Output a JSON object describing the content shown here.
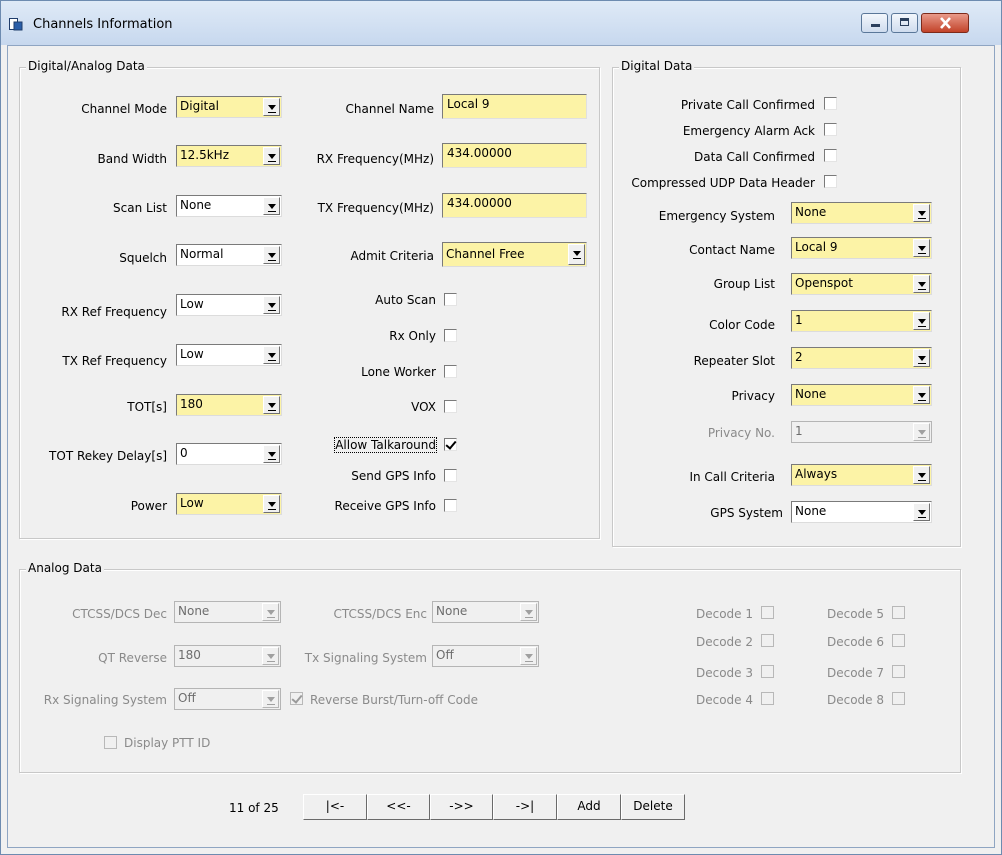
{
  "window": {
    "title": "Channels Information",
    "buttons": {
      "minimize": "minimize-icon",
      "maximize": "maximize-icon",
      "close": "close-icon"
    }
  },
  "digital_analog": {
    "legend": "Digital/Analog Data",
    "channel_mode": {
      "label": "Channel Mode",
      "value": "Digital"
    },
    "band_width": {
      "label": "Band Width",
      "value": "12.5kHz"
    },
    "scan_list": {
      "label": "Scan List",
      "value": "None"
    },
    "squelch": {
      "label": "Squelch",
      "value": "Normal"
    },
    "rx_ref": {
      "label": "RX Ref Frequency",
      "value": "Low"
    },
    "tx_ref": {
      "label": "TX Ref Frequency",
      "value": "Low"
    },
    "tot": {
      "label": "TOT[s]",
      "value": "180"
    },
    "tot_rekey": {
      "label": "TOT Rekey Delay[s]",
      "value": "0"
    },
    "power": {
      "label": "Power",
      "value": "Low"
    },
    "channel_name": {
      "label": "Channel Name",
      "value": "Local 9"
    },
    "rx_freq": {
      "label": "RX Frequency(MHz)",
      "value": "434.00000"
    },
    "tx_freq": {
      "label": "TX Frequency(MHz)",
      "value": "434.00000"
    },
    "admit": {
      "label": "Admit Criteria",
      "value": "Channel Free"
    },
    "auto_scan": {
      "label": "Auto Scan",
      "checked": false
    },
    "rx_only": {
      "label": "Rx Only",
      "checked": false
    },
    "lone_worker": {
      "label": "Lone Worker",
      "checked": false
    },
    "vox": {
      "label": "VOX",
      "checked": false
    },
    "allow_talkaround": {
      "label": "Allow Talkaround",
      "checked": true
    },
    "send_gps": {
      "label": "Send GPS Info",
      "checked": false
    },
    "receive_gps": {
      "label": "Receive GPS Info",
      "checked": false
    }
  },
  "digital": {
    "legend": "Digital Data",
    "private_call": {
      "label": "Private Call Confirmed",
      "checked": false
    },
    "emergency_ack": {
      "label": "Emergency Alarm Ack",
      "checked": false
    },
    "data_call": {
      "label": "Data Call Confirmed",
      "checked": false
    },
    "compressed_udp": {
      "label": "Compressed UDP Data Header",
      "checked": false
    },
    "emergency_system": {
      "label": "Emergency System",
      "value": "None"
    },
    "contact_name": {
      "label": "Contact Name",
      "value": "Local 9"
    },
    "group_list": {
      "label": "Group List",
      "value": "Openspot"
    },
    "color_code": {
      "label": "Color Code",
      "value": "1"
    },
    "repeater_slot": {
      "label": "Repeater Slot",
      "value": "2"
    },
    "privacy": {
      "label": "Privacy",
      "value": "None"
    },
    "privacy_no": {
      "label": "Privacy No.",
      "value": "1"
    },
    "in_call": {
      "label": "In Call Criteria",
      "value": "Always"
    },
    "gps_system": {
      "label": "GPS System",
      "value": "None"
    }
  },
  "analog": {
    "legend": "Analog Data",
    "ctcss_dec": {
      "label": "CTCSS/DCS Dec",
      "value": "None"
    },
    "ctcss_enc": {
      "label": "CTCSS/DCS Enc",
      "value": "None"
    },
    "qt_reverse": {
      "label": "QT Reverse",
      "value": "180"
    },
    "tx_signaling": {
      "label": "Tx Signaling System",
      "value": "Off"
    },
    "rx_signaling": {
      "label": "Rx Signaling System",
      "value": "Off"
    },
    "reverse_burst": {
      "label": "Reverse Burst/Turn-off Code",
      "checked": true
    },
    "display_ptt": {
      "label": "Display PTT ID",
      "checked": false
    },
    "decodes": [
      "Decode 1",
      "Decode 2",
      "Decode 3",
      "Decode 4",
      "Decode 5",
      "Decode 6",
      "Decode 7",
      "Decode 8"
    ]
  },
  "nav": {
    "position": "11 of 25",
    "first": "|<-",
    "prev": "<<-",
    "next": "->>",
    "last": "->|",
    "add": "Add",
    "delete": "Delete"
  }
}
